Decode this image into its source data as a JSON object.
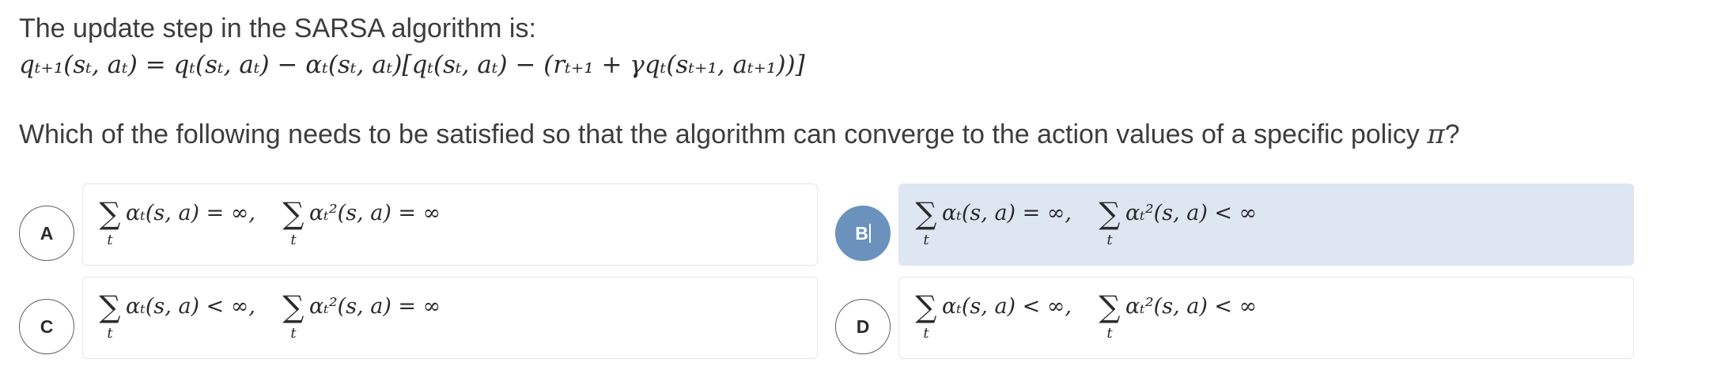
{
  "question": {
    "intro": "The update step in the SARSA algorithm is:",
    "equation": "qₜ₊₁(sₜ, aₜ) = qₜ(sₜ, aₜ) − αₜ(sₜ, aₜ)[qₜ(sₜ, aₜ) − (rₜ₊₁ + γqₜ(sₜ₊₁, aₜ₊₁))]",
    "prompt": "Which of the following needs to be satisfied so that the algorithm can converge to the action values of a specific policy",
    "prompt_symbol": "π",
    "prompt_end": "?"
  },
  "options": [
    {
      "letter": "A",
      "selected": false,
      "sum1_index": "t",
      "term1": "αₜ(s, a) = ∞,",
      "sum2_index": "t",
      "term2": "αₜ²(s, a) = ∞"
    },
    {
      "letter": "B",
      "selected": true,
      "sum1_index": "t",
      "term1": "αₜ(s, a) = ∞,",
      "sum2_index": "t",
      "term2": "αₜ²(s, a) < ∞"
    },
    {
      "letter": "C",
      "selected": false,
      "sum1_index": "t",
      "term1": "αₜ(s, a) < ∞,",
      "sum2_index": "t",
      "term2": "αₜ²(s, a) = ∞"
    },
    {
      "letter": "D",
      "selected": false,
      "sum1_index": "t",
      "term1": "αₜ(s, a) < ∞,",
      "sum2_index": "t",
      "term2": "αₜ²(s, a) < ∞"
    }
  ],
  "sigma_symbol": "∑",
  "colors": {
    "selected_badge": "#6b92bd",
    "selected_box": "#dde6f1",
    "border": "#e6e6e6"
  }
}
